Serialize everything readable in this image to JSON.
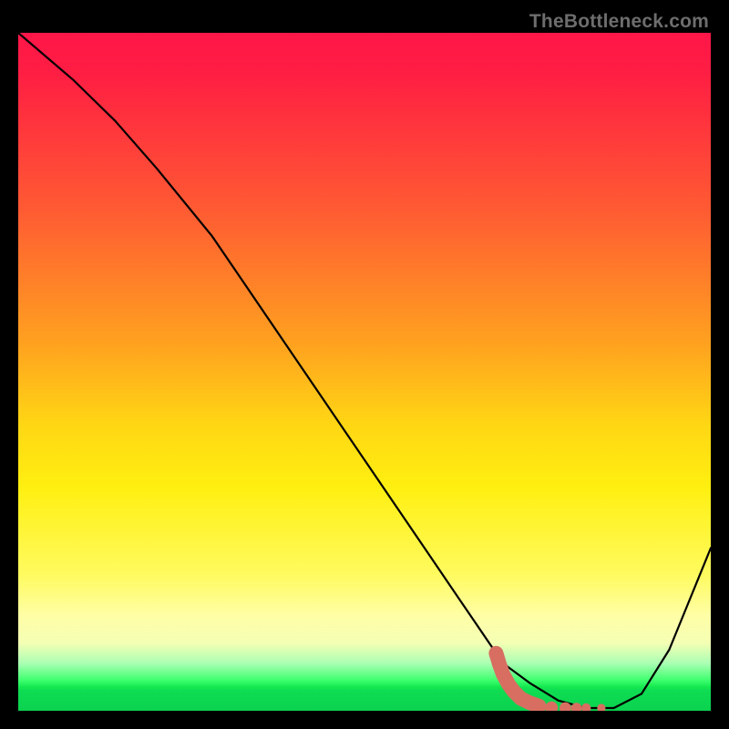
{
  "watermark": "TheBottleneck.com",
  "chart_data": {
    "type": "line",
    "title": "",
    "xlabel": "",
    "ylabel": "",
    "xlim": [
      0,
      100
    ],
    "ylim": [
      0,
      100
    ],
    "series": [
      {
        "name": "bottleneck-curve",
        "x": [
          0,
          8,
          14,
          20,
          28,
          36,
          44,
          52,
          60,
          66,
          70,
          74,
          78,
          82,
          86,
          90,
          94,
          100
        ],
        "values": [
          100,
          93,
          87,
          80,
          70,
          58,
          46,
          34,
          22,
          13,
          7,
          4,
          1.5,
          0.4,
          0.4,
          2.5,
          9,
          24
        ]
      }
    ],
    "markers": {
      "name": "highlight-cluster",
      "color": "#d86e61",
      "points": [
        {
          "x": 69.0,
          "y": 8.5
        },
        {
          "x": 69.5,
          "y": 6.8
        },
        {
          "x": 70.0,
          "y": 5.4
        },
        {
          "x": 70.8,
          "y": 3.9
        },
        {
          "x": 71.6,
          "y": 2.8
        },
        {
          "x": 72.6,
          "y": 1.8
        },
        {
          "x": 73.8,
          "y": 1.2
        },
        {
          "x": 75.2,
          "y": 0.7
        },
        {
          "x": 77.0,
          "y": 0.45
        },
        {
          "x": 79.0,
          "y": 0.4
        },
        {
          "x": 80.6,
          "y": 0.4
        },
        {
          "x": 82.0,
          "y": 0.4
        },
        {
          "x": 84.2,
          "y": 0.4
        }
      ]
    }
  }
}
